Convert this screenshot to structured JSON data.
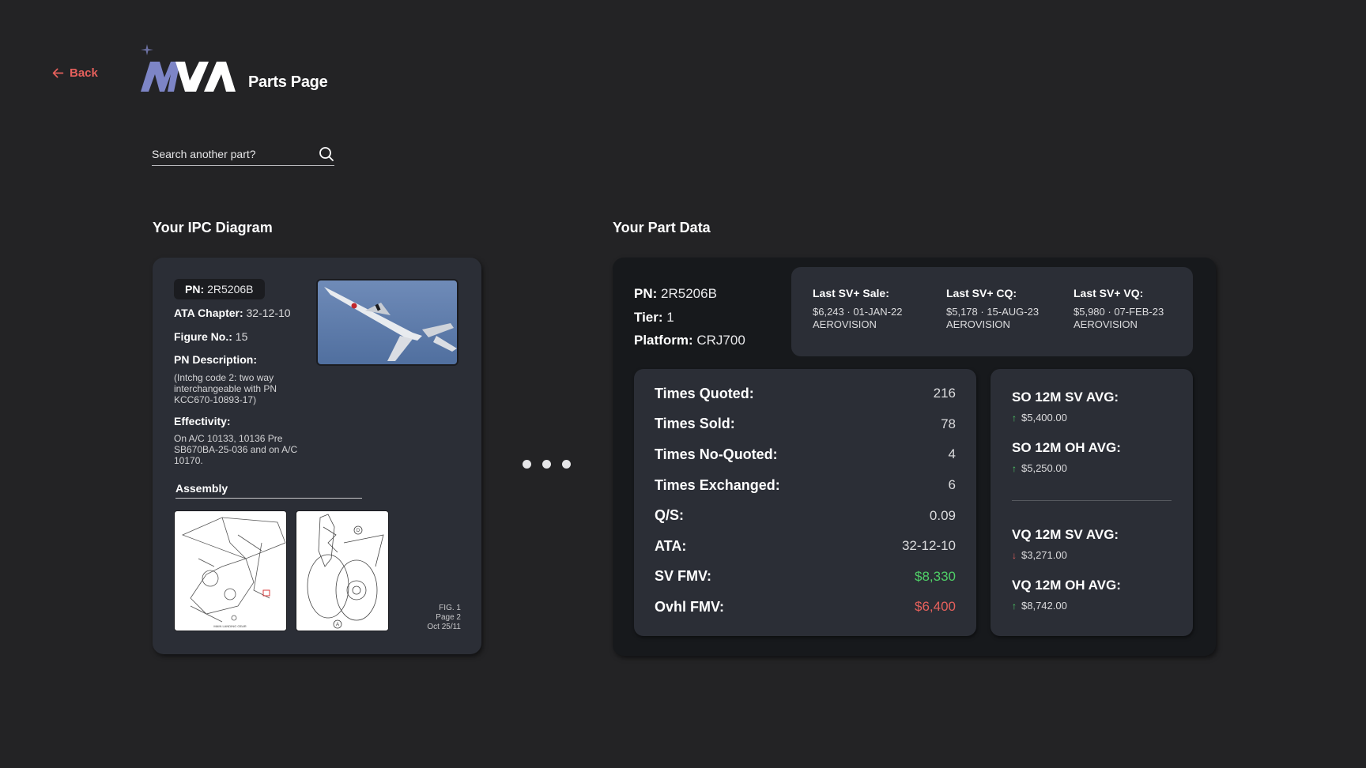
{
  "nav": {
    "back_label": "Back"
  },
  "brand": {
    "logo_text": "MVA",
    "page_label": "Parts Page"
  },
  "search": {
    "placeholder": "Search another part?"
  },
  "ipc": {
    "section_title": "Your IPC Diagram",
    "pn_label": "PN:",
    "pn_value": "2R5206B",
    "ata_label": "ATA Chapter:",
    "ata_value": "32-12-10",
    "figure_label": "Figure No.:",
    "figure_value": "15",
    "desc_label": "PN Description:",
    "desc_value": "(Intchg code 2: two way interchangeable with PN KCC670-10893-17)",
    "effectivity_label": "Effectivity:",
    "effectivity_value": "On A/C 10133, 10136 Pre SB670BA-25-036 and on A/C 10170.",
    "assembly_label": "Assembly",
    "fig_line1": "FIG. 1",
    "fig_line2": "Page 2",
    "fig_line3": "Oct 25/11"
  },
  "part": {
    "section_title": "Your Part Data",
    "pn_label": "PN:",
    "pn_value": "2R5206B",
    "tier_label": "Tier:",
    "tier_value": "1",
    "platform_label": "Platform:",
    "platform_value": "CRJ700",
    "last": [
      {
        "label": "Last SV+ Sale:",
        "value": "$6,243 · 01-JAN-22",
        "vendor": "AEROVISION"
      },
      {
        "label": "Last SV+ CQ:",
        "value": "$5,178 · 15-AUG-23",
        "vendor": "AEROVISION"
      },
      {
        "label": "Last SV+ VQ:",
        "value": "$5,980 · 07-FEB-23",
        "vendor": "AEROVISION"
      }
    ],
    "stats": [
      {
        "label": "Times Quoted:",
        "value": "216"
      },
      {
        "label": "Times Sold:",
        "value": "78"
      },
      {
        "label": "Times No-Quoted:",
        "value": "4"
      },
      {
        "label": "Times Exchanged:",
        "value": "6"
      },
      {
        "label": "Q/S:",
        "value": "0.09"
      },
      {
        "label": "ATA:",
        "value": "32-12-10"
      },
      {
        "label": "SV FMV:",
        "value": "$8,330",
        "color": "#4fcf67"
      },
      {
        "label": "Ovhl FMV:",
        "value": "$6,400",
        "color": "#e5605c"
      }
    ],
    "averages": [
      {
        "label": "SO 12M SV AVG:",
        "value": "$5,400.00",
        "trend": "up"
      },
      {
        "label": "SO 12M OH AVG:",
        "value": "$5,250.00",
        "trend": "up"
      },
      {
        "label": "VQ 12M SV AVG:",
        "value": "$3,271.00",
        "trend": "down"
      },
      {
        "label": "VQ 12M OH AVG:",
        "value": "$8,742.00",
        "trend": "up"
      }
    ]
  },
  "colors": {
    "accent_red": "#e5605c",
    "positive_green": "#4fcf67",
    "logo_blue": "#7d85c6"
  },
  "icons": [
    "arrow-left-icon",
    "search-icon",
    "trend-up-icon",
    "trend-down-icon"
  ]
}
